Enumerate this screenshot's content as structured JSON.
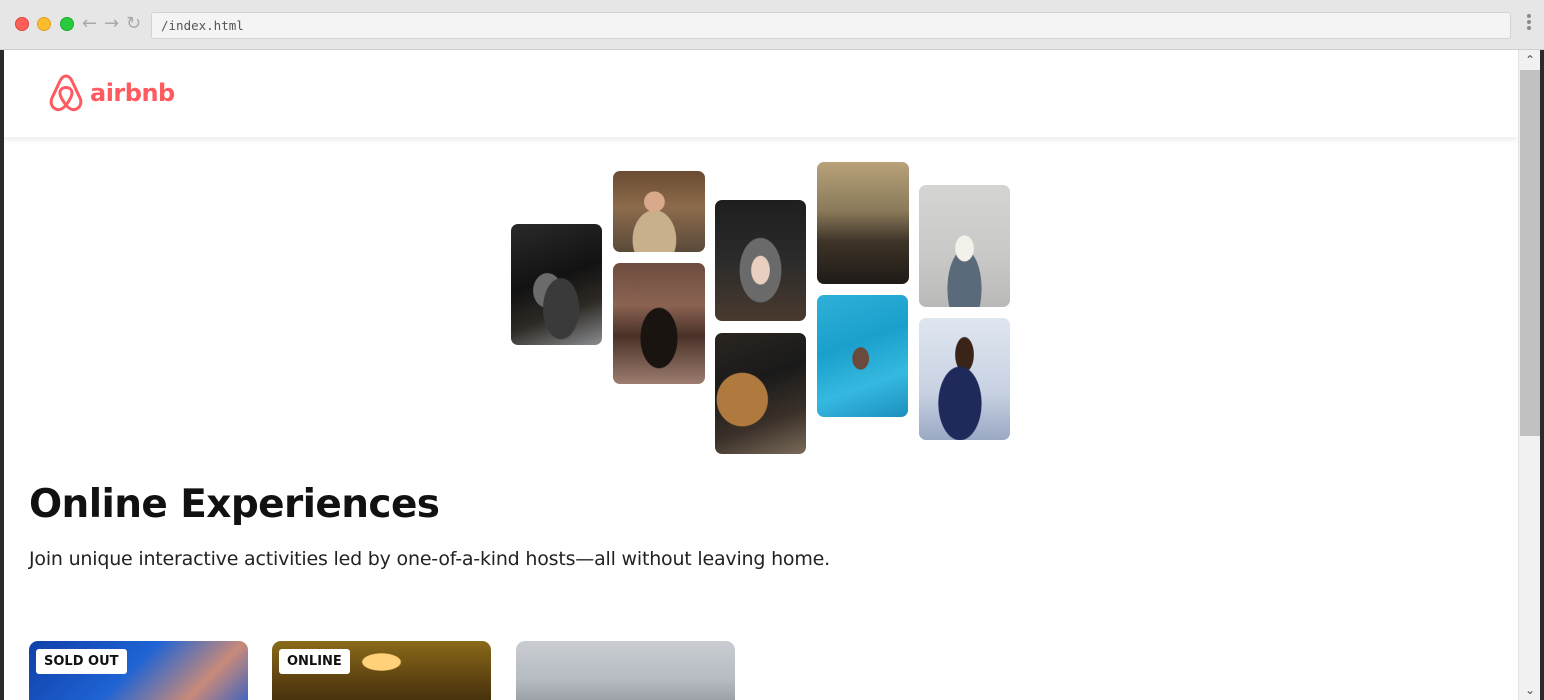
{
  "browser": {
    "url": "/index.html",
    "back_icon": "arrow-left-icon",
    "forward_icon": "arrow-right-icon",
    "reload_icon": "reload-icon",
    "menu_icon": "kebab-menu-icon"
  },
  "header": {
    "logo_text": "airbnb",
    "brand_color": "#ff5a5f"
  },
  "hero": {
    "title": "Online Experiences",
    "subtitle": "Join unique interactive activities led by one-of-a-kind hosts—all without leaving home.",
    "photos": [
      "cooking-pans-photo",
      "chef-woman-photo",
      "dancer-doorway-photo",
      "food-bowl-photo",
      "guitar-photo",
      "microphone-keyboard-photo",
      "swimmer-photo",
      "yoga-photo",
      "singer-photo"
    ]
  },
  "cards": [
    {
      "badge": "SOLD OUT"
    },
    {
      "badge": "ONLINE"
    },
    {
      "badge": ""
    }
  ]
}
